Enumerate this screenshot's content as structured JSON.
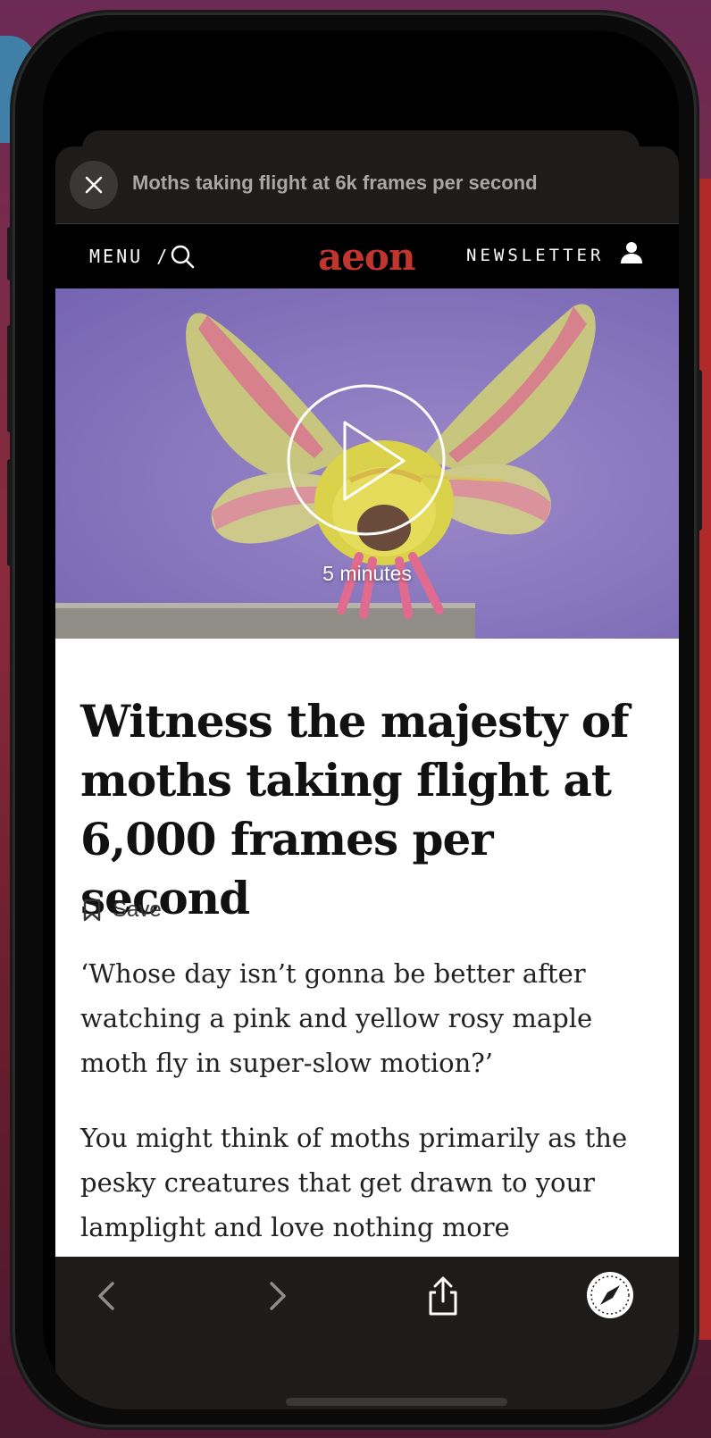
{
  "sheet": {
    "title": "Moths taking flight at 6k frames per second",
    "close_icon": "close-icon"
  },
  "nav": {
    "menu_label": "MENU /",
    "logo": "aeon",
    "newsletter_label": "NEWSLETTER",
    "icons": [
      "search-icon",
      "user-icon"
    ]
  },
  "hero": {
    "duration": "5 minutes",
    "play_icon": "play-icon"
  },
  "article": {
    "headline": "Witness the majesty of moths taking flight at 6,000 frames per second",
    "save_label": "Save",
    "standfirst": "‘Whose day isn’t gonna be better after watching a pink and yellow rosy maple moth fly in super-slow motion?’",
    "body": "You might think of moths primarily as the pesky creatures that get drawn to your lamplight and love nothing more"
  },
  "toolbar": {
    "icons": [
      "back-arrow-icon",
      "forward-arrow-icon",
      "share-icon",
      "safari-compass-icon"
    ]
  },
  "colors": {
    "brand": "#c0352d",
    "sheet_bg": "#1e1c1b",
    "hero_bg": "#8a78c0"
  }
}
